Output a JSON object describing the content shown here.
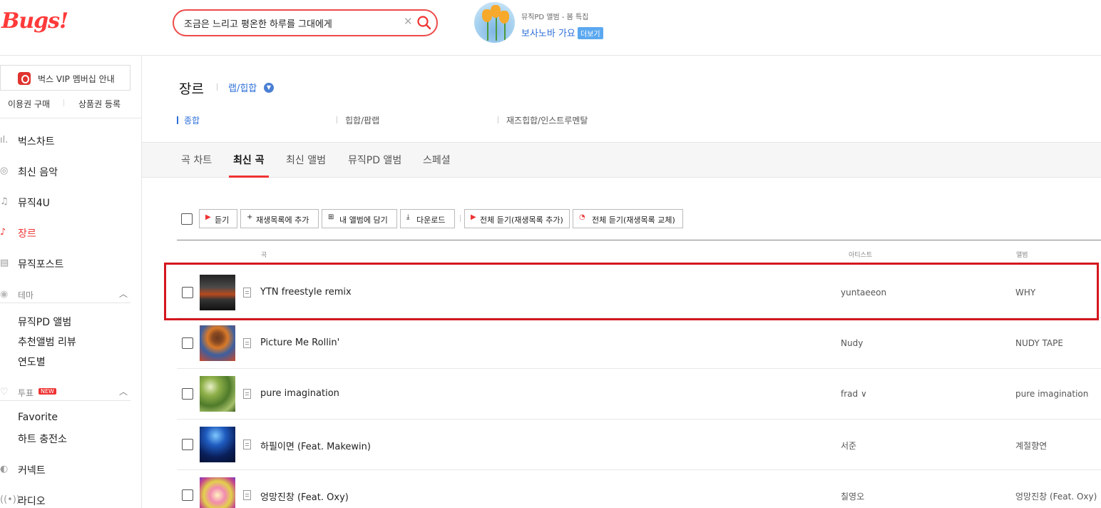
{
  "header": {
    "logo": "Bugs!",
    "search": {
      "value": "조금은 느리고 평온한 하루를 그대에게",
      "placeholder": ""
    },
    "promo": {
      "subtitle": "뮤직PD 앨범 - 봄 특집",
      "title": "보사노바 가요",
      "more_label": "더보기"
    }
  },
  "sidebar": {
    "vip_label": "벅스 VIP 멤버십 안내",
    "purchase_label": "이용권 구매",
    "voucher_label": "상품권 등록",
    "nav": [
      {
        "label": "벅스차트"
      },
      {
        "label": "최신 음악"
      },
      {
        "label": "뮤직4U"
      },
      {
        "label": "장르"
      },
      {
        "label": "뮤직포스트"
      }
    ],
    "theme": {
      "label": "테마",
      "items": [
        "뮤직PD 앨범",
        "추천앨범 리뷰",
        "연도별"
      ]
    },
    "vote": {
      "label": "투표",
      "badge": "NEW",
      "items": [
        "Favorite",
        "하트 충전소"
      ]
    },
    "bottom": [
      {
        "label": "커넥트"
      },
      {
        "label": "라디오"
      }
    ]
  },
  "main": {
    "title": "장르",
    "genre": "랩/힙합",
    "subgenres": [
      "종합",
      "힙합/팝랩",
      "재즈힙합/인스트루멘탈"
    ],
    "tabs": [
      "곡 차트",
      "최신 곡",
      "최신 앨범",
      "뮤직PD 앨범",
      "스페셜"
    ],
    "active_tab": "최신 곡",
    "toolbar": {
      "listen": "듣기",
      "add_playlist": "재생목록에 추가",
      "add_album": "내 앨범에 담기",
      "download": "다운로드",
      "play_all_add": "전체 듣기(재생목록 추가)",
      "play_all_replace": "전체 듣기(재생목록 교체)"
    },
    "columns": {
      "song": "곡",
      "artist": "아티스트",
      "album": "앨범"
    },
    "rows": [
      {
        "title": "YTN freestyle remix",
        "artist": "yuntaeeon",
        "album": "WHY"
      },
      {
        "title": "Picture Me Rollin'",
        "artist": "Nudy",
        "album": "NUDY TAPE"
      },
      {
        "title": "pure imagination",
        "artist": "frad ∨",
        "album": "pure imagination"
      },
      {
        "title": "하필이면 (Feat. Makewin)",
        "artist": "서준",
        "album": "계절향연"
      },
      {
        "title": "엉망진창 (Feat. Oxy)",
        "artist": "칠영오",
        "album": "엉망진창 (Feat. Oxy)"
      }
    ]
  },
  "colors": {
    "brand": "#ff3a3a",
    "accent": "#2d6fd8",
    "highlight": "#d4171e"
  }
}
